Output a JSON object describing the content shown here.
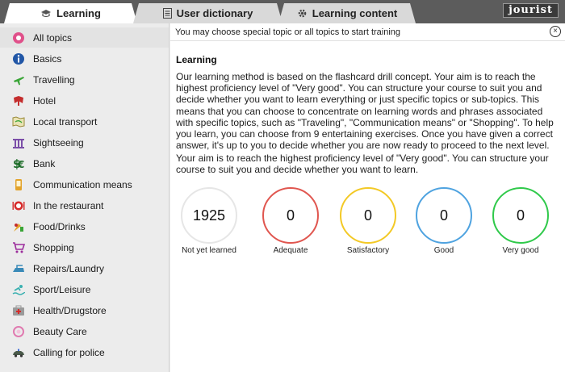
{
  "tabs": [
    {
      "label": "Learning",
      "icon": "mortarboard-icon"
    },
    {
      "label": "User dictionary",
      "icon": "dictionary-icon"
    },
    {
      "label": "Learning content",
      "icon": "gear-icon"
    }
  ],
  "brand": "jourist",
  "sidebar": {
    "items": [
      {
        "label": "All topics",
        "icon": "all-topics-icon",
        "color": "#e0508a"
      },
      {
        "label": "Basics",
        "icon": "info-icon",
        "color": "#2156a6"
      },
      {
        "label": "Travelling",
        "icon": "airplane-icon",
        "color": "#3aa537"
      },
      {
        "label": "Hotel",
        "icon": "hotel-icon",
        "color": "#c42d2d"
      },
      {
        "label": "Local transport",
        "icon": "map-icon",
        "color": "#9a8a3a"
      },
      {
        "label": "Sightseeing",
        "icon": "monument-icon",
        "color": "#7b4ea8"
      },
      {
        "label": "Bank",
        "icon": "money-icon",
        "color": "#1f6e2b"
      },
      {
        "label": "Communication means",
        "icon": "phone-icon",
        "color": "#e3a32a"
      },
      {
        "label": "In the restaurant",
        "icon": "restaurant-icon",
        "color": "#d62b2b"
      },
      {
        "label": "Food/Drinks",
        "icon": "food-icon",
        "color": "#8a3a2a"
      },
      {
        "label": "Shopping",
        "icon": "cart-icon",
        "color": "#9c2d9c"
      },
      {
        "label": "Repairs/Laundry",
        "icon": "iron-icon",
        "color": "#3a8ab8"
      },
      {
        "label": "Sport/Leisure",
        "icon": "swimmer-icon",
        "color": "#3ab0b0"
      },
      {
        "label": "Health/Drugstore",
        "icon": "first-aid-icon",
        "color": "#9a9a9a"
      },
      {
        "label": "Beauty Care",
        "icon": "beauty-icon",
        "color": "#e07ab0"
      },
      {
        "label": "Calling for police",
        "icon": "police-car-icon",
        "color": "#4a5a4a"
      }
    ]
  },
  "info_bar": {
    "text": "You may choose special topic or all topics to start training",
    "close": "⊗"
  },
  "lesson": {
    "title": "Learning",
    "paragraph1": "Our learning method is based on the flashcard drill concept. Your aim is to reach the highest proficiency level of \"Very good\". You can structure your course to suit you and decide whether you want to learn everything or just specific topics or sub-topics. This means that you can choose to concentrate on learning words and phrases associated with specific topics, such as \"Traveling\", \"Communication means\" or \"Shopping\". To help you learn, you can choose from 9 entertaining exercises. Once you have given a correct answer, it's up to you to decide whether you are now ready to proceed to the next level.",
    "paragraph2": "Your aim is to reach the highest proficiency level of \"Very good\". You can structure your course to suit you and decide whether you want to learn."
  },
  "levels": [
    {
      "value": "1925",
      "label": "Not yet learned",
      "color": "#e6e6e6"
    },
    {
      "value": "0",
      "label": "Adequate",
      "color": "#e0564f"
    },
    {
      "value": "0",
      "label": "Satisfactory",
      "color": "#f3c926"
    },
    {
      "value": "0",
      "label": "Good",
      "color": "#4fa3e0"
    },
    {
      "value": "0",
      "label": "Very good",
      "color": "#2fc94a"
    }
  ]
}
